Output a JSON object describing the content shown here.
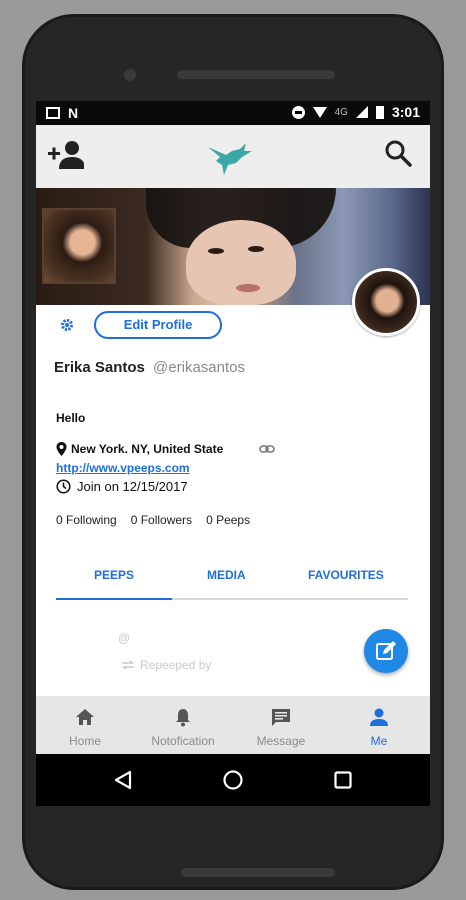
{
  "status_bar": {
    "network": "4G",
    "time": "3:01"
  },
  "app_bar": {
    "add_user_icon": "person-add-icon",
    "logo_icon": "hummingbird-logo",
    "search_icon": "search-icon"
  },
  "profile": {
    "edit_button": "Edit Profile",
    "display_name": "Erika Santos",
    "username": "@erikasantos",
    "bio": "Hello",
    "location": "New York. NY, United State",
    "website": "http://www.vpeeps.com",
    "joined": "Join on 12/15/2017",
    "stats": {
      "following": "0 Following",
      "followers": "0 Followers",
      "peeps": "0 Peeps"
    }
  },
  "tabs": [
    {
      "label": "PEEPS",
      "active": true
    },
    {
      "label": "MEDIA",
      "active": false
    },
    {
      "label": "FAVOURITES",
      "active": false
    }
  ],
  "feed": {
    "at_sign": "@",
    "repeeped_label": "Repeeped by"
  },
  "bottom_nav": [
    {
      "label": "Home",
      "icon": "home-icon",
      "active": false
    },
    {
      "label": "Notofication",
      "icon": "bell-icon",
      "active": false
    },
    {
      "label": "Message",
      "icon": "chat-icon",
      "active": false
    },
    {
      "label": "Me",
      "icon": "person-icon",
      "active": true
    }
  ],
  "colors": {
    "accent": "#1e6fd9",
    "fab": "#1e88e5",
    "logo": "#3aa8a3"
  }
}
